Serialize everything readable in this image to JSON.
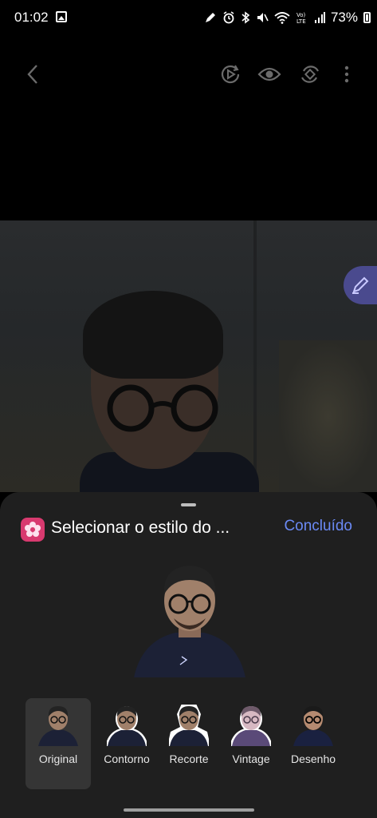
{
  "status_bar": {
    "time": "01:02",
    "battery": "73%",
    "icons": [
      "gallery-notification-icon",
      "pen-icon",
      "alarm-icon",
      "bluetooth-icon",
      "mute-icon",
      "wifi-icon",
      "volte-icon",
      "signal-icon",
      "battery-icon"
    ]
  },
  "toolbar": {
    "icons": [
      "back-icon",
      "motion-photo-icon",
      "eye-icon",
      "rotate-icon",
      "more-icon"
    ]
  },
  "sheet": {
    "title": "Selecionar o estilo do ...",
    "done_label": "Concluído"
  },
  "styles": [
    {
      "label": "Original",
      "selected": true
    },
    {
      "label": "Contorno",
      "selected": false
    },
    {
      "label": "Recorte",
      "selected": false
    },
    {
      "label": "Vintage",
      "selected": false
    },
    {
      "label": "Desenho",
      "selected": false
    }
  ],
  "colors": {
    "accent": "#6b8af5",
    "sheet_bg": "#1f1f1f",
    "selected_bg": "#353535",
    "edit_fab": "#4a4a8e",
    "app_icon": "#d83a6f"
  }
}
